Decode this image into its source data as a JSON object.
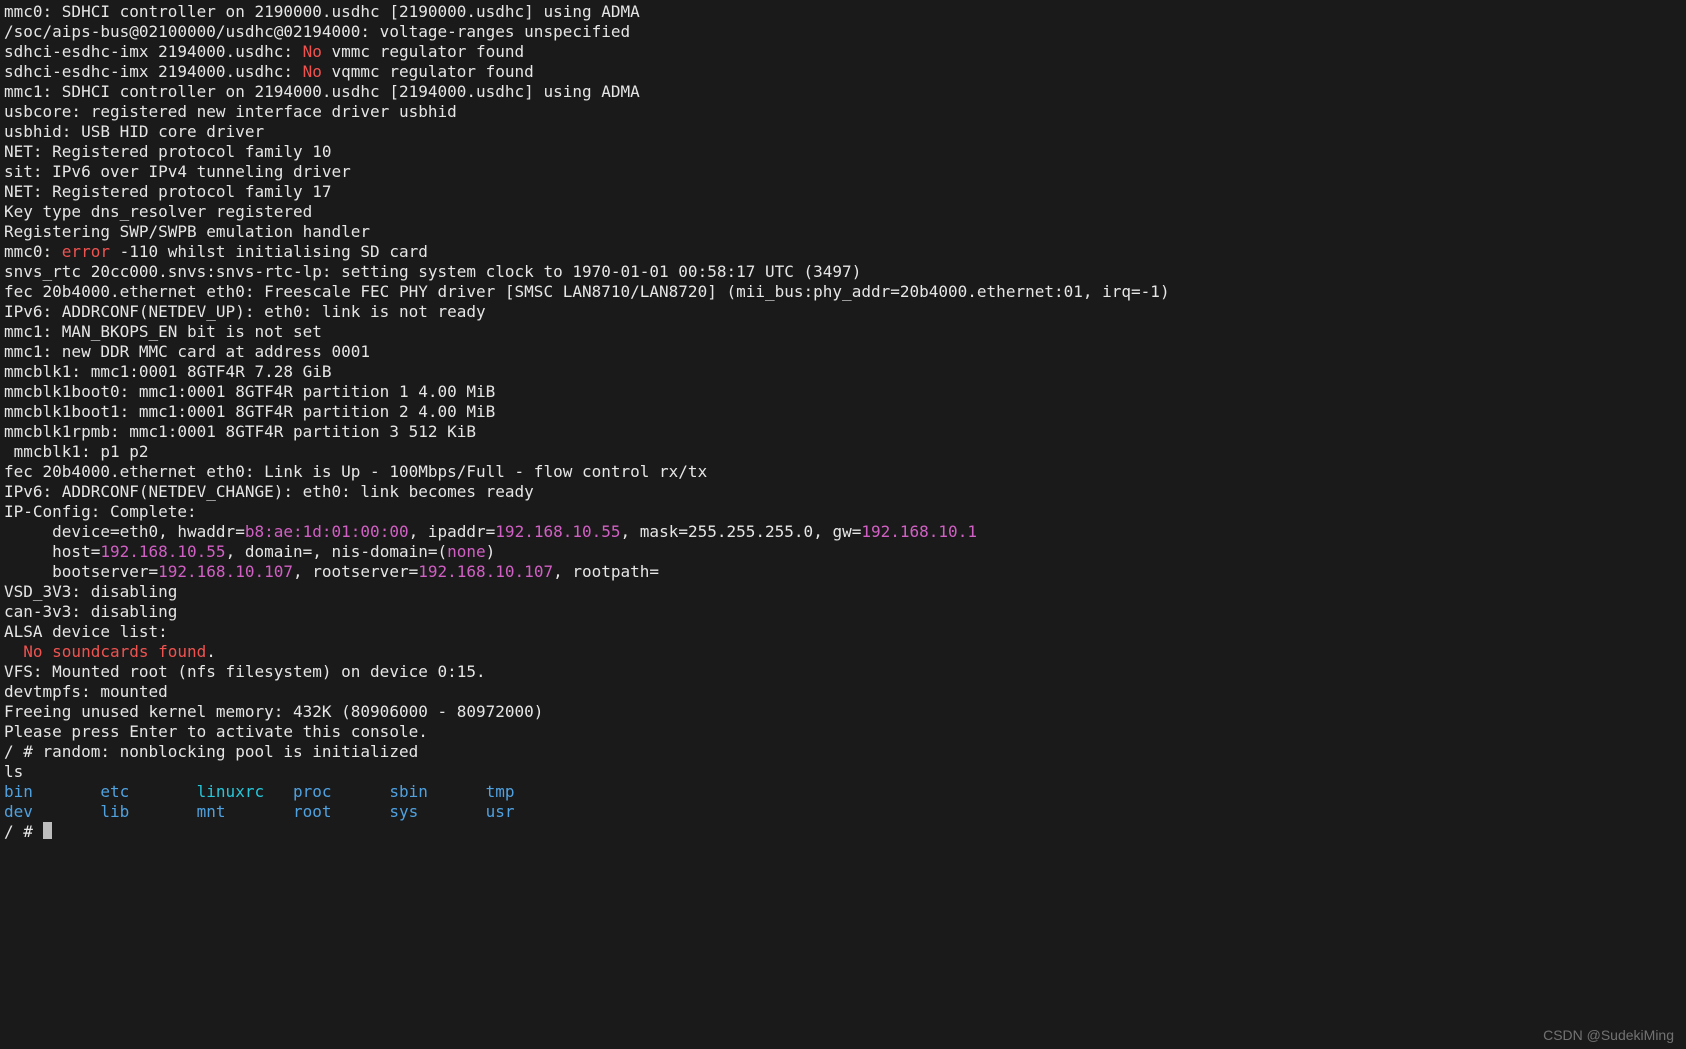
{
  "lines": [
    [
      {
        "t": "mmc0: SDHCI controller on 2190000.usdhc [2190000.usdhc] using ADMA"
      }
    ],
    [
      {
        "t": "/soc/aips-bus@02100000/usdhc@02194000: voltage-ranges unspecified"
      }
    ],
    [
      {
        "t": "sdhci-esdhc-imx 2194000.usdhc: "
      },
      {
        "t": "No",
        "cls": "red"
      },
      {
        "t": " vmmc regulator found"
      }
    ],
    [
      {
        "t": "sdhci-esdhc-imx 2194000.usdhc: "
      },
      {
        "t": "No",
        "cls": "red"
      },
      {
        "t": " vqmmc regulator found"
      }
    ],
    [
      {
        "t": "mmc1: SDHCI controller on 2194000.usdhc [2194000.usdhc] using ADMA"
      }
    ],
    [
      {
        "t": "usbcore: registered new interface driver usbhid"
      }
    ],
    [
      {
        "t": "usbhid: USB HID core driver"
      }
    ],
    [
      {
        "t": "NET: Registered protocol family 10"
      }
    ],
    [
      {
        "t": "sit: IPv6 over IPv4 tunneling driver"
      }
    ],
    [
      {
        "t": "NET: Registered protocol family 17"
      }
    ],
    [
      {
        "t": "Key type dns_resolver registered"
      }
    ],
    [
      {
        "t": "Registering SWP/SWPB emulation handler"
      }
    ],
    [
      {
        "t": "mmc0: "
      },
      {
        "t": "error",
        "cls": "red"
      },
      {
        "t": " -110 whilst initialising SD card"
      }
    ],
    [
      {
        "t": "snvs_rtc 20cc000.snvs:snvs-rtc-lp: setting system clock to 1970-01-01 00:58:17 UTC (3497)"
      }
    ],
    [
      {
        "t": "fec 20b4000.ethernet eth0: Freescale FEC PHY driver [SMSC LAN8710/LAN8720] (mii_bus:phy_addr=20b4000.ethernet:01, irq=-1)"
      }
    ],
    [
      {
        "t": "IPv6: ADDRCONF(NETDEV_UP): eth0: link is not ready"
      }
    ],
    [
      {
        "t": "mmc1: MAN_BKOPS_EN bit is not set"
      }
    ],
    [
      {
        "t": "mmc1: new DDR MMC card at address 0001"
      }
    ],
    [
      {
        "t": "mmcblk1: mmc1:0001 8GTF4R 7.28 GiB"
      }
    ],
    [
      {
        "t": "mmcblk1boot0: mmc1:0001 8GTF4R partition 1 4.00 MiB"
      }
    ],
    [
      {
        "t": "mmcblk1boot1: mmc1:0001 8GTF4R partition 2 4.00 MiB"
      }
    ],
    [
      {
        "t": "mmcblk1rpmb: mmc1:0001 8GTF4R partition 3 512 KiB"
      }
    ],
    [
      {
        "t": " mmcblk1: p1 p2"
      }
    ],
    [
      {
        "t": "fec 20b4000.ethernet eth0: Link is Up - 100Mbps/Full - flow control rx/tx"
      }
    ],
    [
      {
        "t": "IPv6: ADDRCONF(NETDEV_CHANGE): eth0: link becomes ready"
      }
    ],
    [
      {
        "t": "IP-Config: Complete:"
      }
    ],
    [
      {
        "t": "     device=eth0, hwaddr="
      },
      {
        "t": "b8:ae:1d:01:00:00",
        "cls": "magenta"
      },
      {
        "t": ", ipaddr="
      },
      {
        "t": "192.168.10.55",
        "cls": "magenta"
      },
      {
        "t": ", mask=255.255.255.0, gw="
      },
      {
        "t": "192.168.10.1",
        "cls": "magenta"
      }
    ],
    [
      {
        "t": "     host="
      },
      {
        "t": "192.168.10.55",
        "cls": "magenta"
      },
      {
        "t": ", domain=, nis-domain=("
      },
      {
        "t": "none",
        "cls": "magenta"
      },
      {
        "t": ")"
      }
    ],
    [
      {
        "t": "     bootserver="
      },
      {
        "t": "192.168.10.107",
        "cls": "magenta"
      },
      {
        "t": ", rootserver="
      },
      {
        "t": "192.168.10.107",
        "cls": "magenta"
      },
      {
        "t": ", rootpath="
      }
    ],
    [
      {
        "t": "VSD_3V3: disabling"
      }
    ],
    [
      {
        "t": "can-3v3: disabling"
      }
    ],
    [
      {
        "t": "ALSA device list:"
      }
    ],
    [
      {
        "t": "  "
      },
      {
        "t": "No soundcards found",
        "cls": "red"
      },
      {
        "t": "."
      }
    ],
    [
      {
        "t": "VFS: Mounted root (nfs filesystem) on device 0:15."
      }
    ],
    [
      {
        "t": "devtmpfs: mounted"
      }
    ],
    [
      {
        "t": "Freeing unused kernel memory: 432K (80906000 - 80972000)"
      }
    ],
    [
      {
        "t": ""
      }
    ],
    [
      {
        "t": "Please press Enter to activate this console."
      }
    ],
    [
      {
        "t": "/ # random: nonblocking pool is initialized"
      }
    ],
    [
      {
        "t": "ls"
      }
    ]
  ],
  "ls_rows": [
    [
      {
        "name": "bin",
        "cls": "blue"
      },
      {
        "name": "etc",
        "cls": "blue"
      },
      {
        "name": "linuxrc",
        "cls": "cyan"
      },
      {
        "name": "proc",
        "cls": "blue"
      },
      {
        "name": "sbin",
        "cls": "blue"
      },
      {
        "name": "tmp",
        "cls": "blue"
      }
    ],
    [
      {
        "name": "dev",
        "cls": "blue"
      },
      {
        "name": "lib",
        "cls": "blue"
      },
      {
        "name": "mnt",
        "cls": "blue"
      },
      {
        "name": "root",
        "cls": "blue"
      },
      {
        "name": "sys",
        "cls": "blue"
      },
      {
        "name": "usr",
        "cls": "blue"
      }
    ]
  ],
  "prompt": "/ # ",
  "watermark": "CSDN @SudekiMing"
}
